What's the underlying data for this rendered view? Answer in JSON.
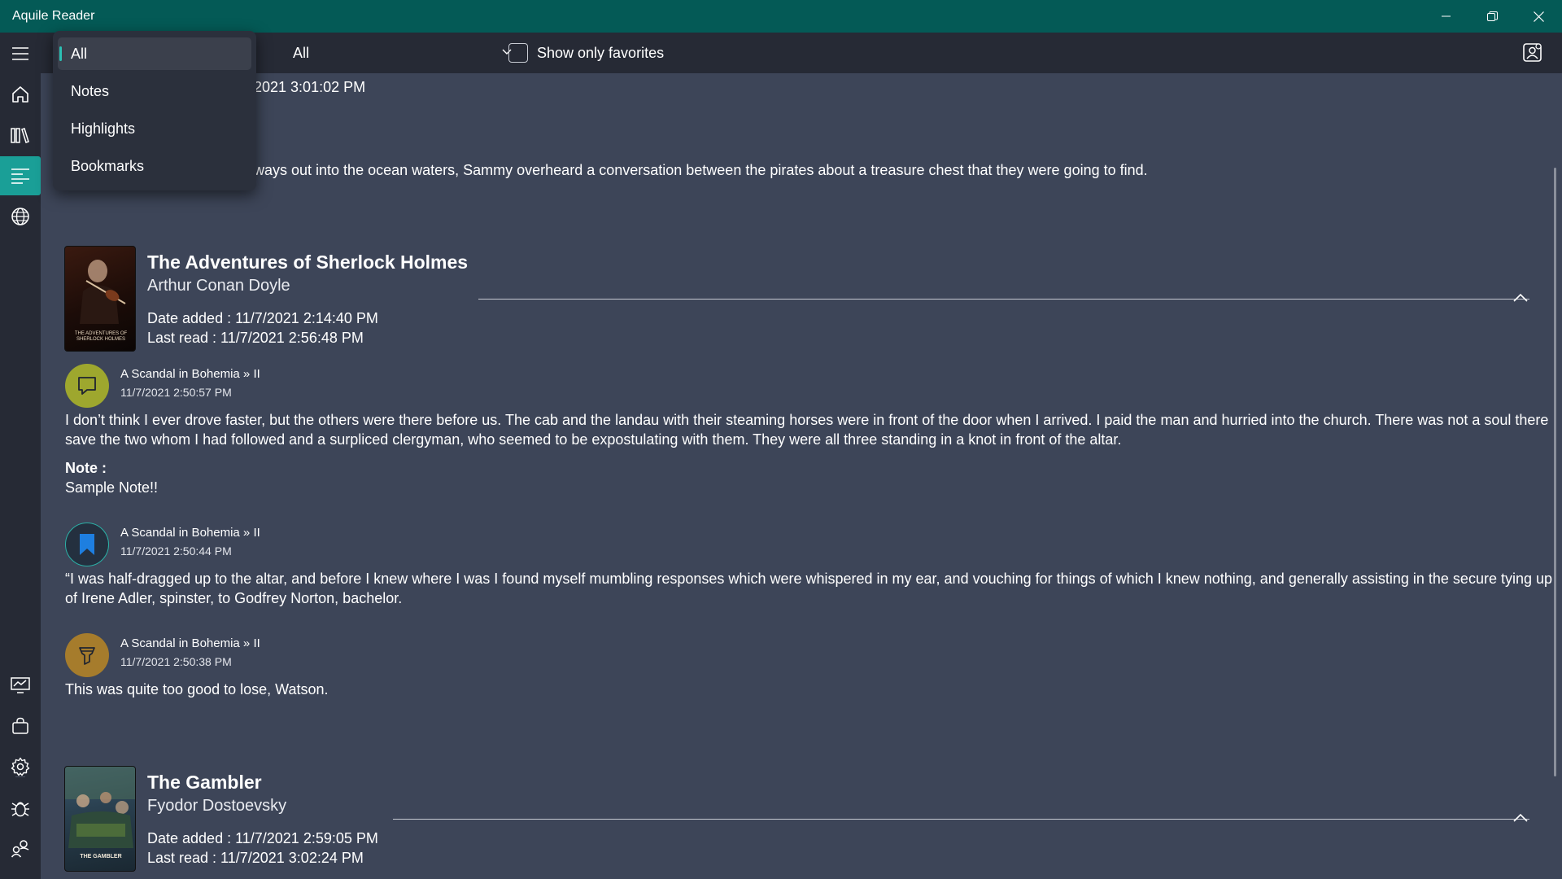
{
  "window": {
    "title": "Aquile Reader"
  },
  "toolbar": {
    "type_filter_value": "All",
    "favorites_label": "Show only favorites"
  },
  "filter_menu": {
    "items": [
      {
        "label": "All",
        "selected": true
      },
      {
        "label": "Notes",
        "selected": false
      },
      {
        "label": "Highlights",
        "selected": false
      },
      {
        "label": "Bookmarks",
        "selected": false
      }
    ]
  },
  "nav": {
    "items": [
      "menu-icon",
      "home-icon",
      "library-icon",
      "annotations-icon",
      "globe-icon",
      "stats-icon",
      "store-icon",
      "gear-icon",
      "bug-icon",
      "community-icon"
    ],
    "active": "annotations-icon"
  },
  "partial_top": {
    "date_fragment": "2021 3:01:02 PM",
    "text_fragment": "ways out into the ocean waters, Sammy overheard a conversation between the pirates about a treasure chest that they were going to find."
  },
  "books": [
    {
      "title": "The Adventures of Sherlock Holmes",
      "author": "Arthur Conan Doyle",
      "date_added": "Date added : 11/7/2021 2:14:40 PM",
      "last_read": "Last read : 11/7/2021 2:56:48 PM",
      "cover_text": "THE ADVENTURES OF SHERLOCK HOLMES",
      "annotations": [
        {
          "kind": "note",
          "icon": "note-icon",
          "color": "#9ea72e",
          "chapter": "A Scandal in Bohemia » II",
          "date": "11/7/2021 2:50:57 PM",
          "text": "I don’t think I ever drove faster, but the others were there before us. The cab and the landau with their steaming horses were in front of the door when I arrived. I paid the man and hurried into the church. There was not a soul there save the two whom I had followed and a surpliced clergyman, who seemed to be expostulating with them. They were all three standing in a knot in front of the altar.",
          "note_label": "Note :",
          "note_text": "Sample Note!!"
        },
        {
          "kind": "bookmark",
          "icon": "bookmark-icon",
          "color": "#1e7fe0",
          "chapter": "A Scandal in Bohemia » II",
          "date": "11/7/2021 2:50:44 PM",
          "text": "“I was half-dragged up to the altar, and before I knew where I was I found myself mumbling responses which were whispered in my ear, and vouching for things of which I knew nothing, and generally assisting in the secure tying up of Irene Adler, spinster, to Godfrey Norton, bachelor."
        },
        {
          "kind": "highlight",
          "icon": "highlighter-icon",
          "color": "#a67c2c",
          "chapter": "A Scandal in Bohemia » II",
          "date": "11/7/2021 2:50:38 PM",
          "text": "This was quite too good to lose, Watson."
        }
      ]
    },
    {
      "title": "The Gambler",
      "author": "Fyodor Dostoevsky",
      "date_added": "Date added : 11/7/2021 2:59:05 PM",
      "last_read": "Last read : 11/7/2021 3:02:24 PM",
      "cover_text": "THE GAMBLER"
    }
  ],
  "colors": {
    "titlebar": "#045a56",
    "accent": "#1a9f97",
    "background": "#3d4558",
    "chrome": "#262a35"
  }
}
